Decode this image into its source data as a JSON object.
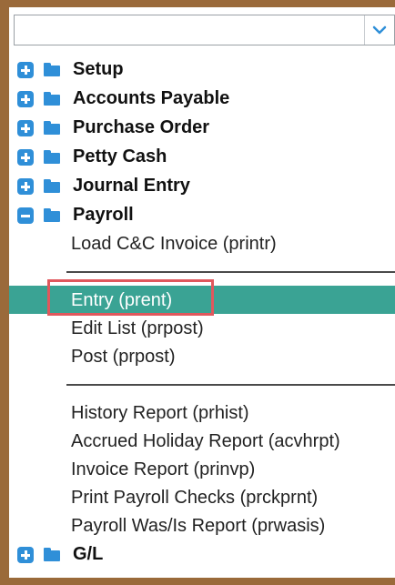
{
  "dropdown": {
    "value": "",
    "icon": "chevron-down-icon",
    "icon_color": "#2f8fd8"
  },
  "tree": {
    "accent_color": "#2f8fd8",
    "selected_color": "#3aa394",
    "highlight_color": "#e0585d",
    "nodes_top": [
      {
        "label": "Setup",
        "state": "collapsed"
      },
      {
        "label": "Accounts Payable",
        "state": "collapsed"
      },
      {
        "label": "Purchase Order",
        "state": "collapsed"
      },
      {
        "label": "Petty Cash",
        "state": "collapsed"
      },
      {
        "label": "Journal Entry",
        "state": "collapsed"
      },
      {
        "label": "Payroll",
        "state": "expanded"
      }
    ],
    "payroll_items": {
      "load": "Load C&C Invoice (printr)",
      "entry": "Entry (prent)",
      "edit_list": "Edit List (prpost)",
      "post": "Post (prpost)",
      "history": "History Report (prhist)",
      "accrued": "Accrued Holiday Report (acvhrpt)",
      "invoice": "Invoice Report (prinvp)",
      "print_checks": "Print Payroll Checks (prckprnt)",
      "was_is": "Payroll Was/Is Report (prwasis)"
    },
    "node_gl": {
      "label": "G/L",
      "state": "collapsed"
    }
  }
}
